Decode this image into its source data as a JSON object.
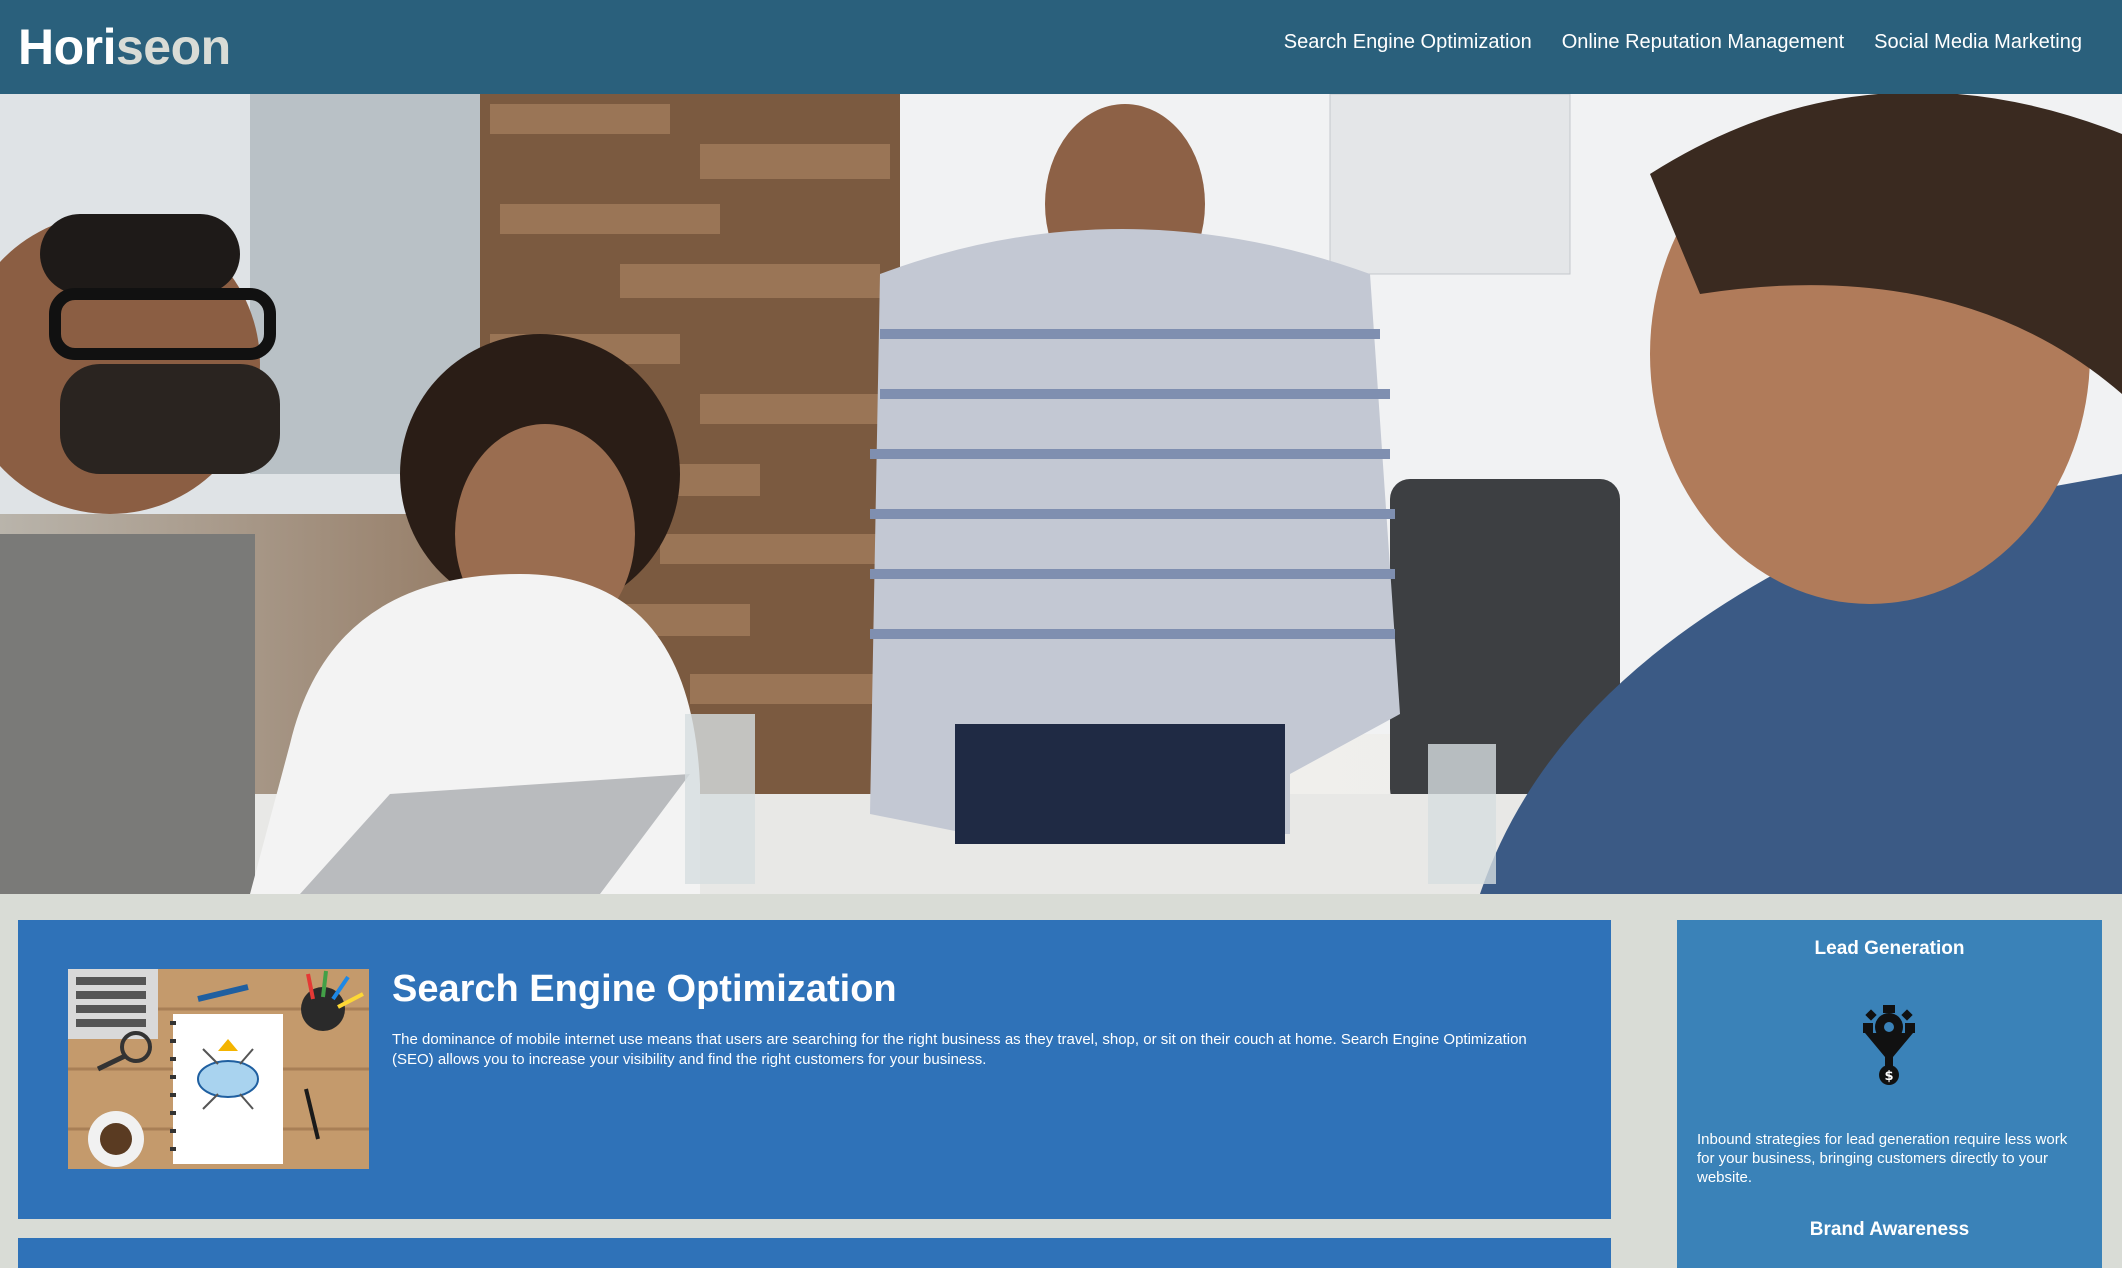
{
  "header": {
    "logo_main": "Hori",
    "logo_accent": "seon",
    "nav": [
      {
        "label": "Search Engine Optimization"
      },
      {
        "label": "Online Reputation Management"
      },
      {
        "label": "Social Media Marketing"
      }
    ]
  },
  "hero": {
    "image": "office-meeting-photo"
  },
  "main": {
    "section1": {
      "image": "seo-notebook-photo",
      "title": "Search Engine Optimization",
      "text": "The dominance of mobile internet use means that users are searching for the right business as they travel, shop, or sit on their couch at home. Search Engine Optimization (SEO) allows you to increase your visibility and find the right customers for your business."
    }
  },
  "sidebar": {
    "items": [
      {
        "title": "Lead Generation",
        "icon": "lead-funnel-icon",
        "text": "Inbound strategies for lead generation require less work for your business, bringing customers directly to your website."
      },
      {
        "title": "Brand Awareness"
      }
    ]
  },
  "colors": {
    "header_bg": "#2a607c",
    "page_bg": "#d9dcd6",
    "card_bg": "#2f72b8",
    "sidebar_bg": "#3a82b8",
    "logo_accent": "#d9dcd6"
  }
}
